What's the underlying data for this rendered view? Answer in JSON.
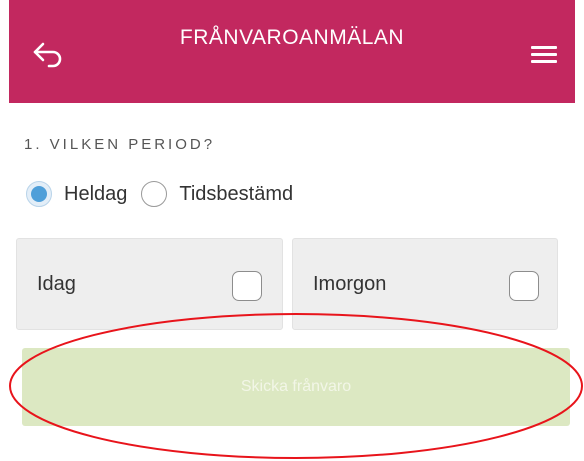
{
  "header": {
    "title": "FRÅNVAROANMÄLAN",
    "background_color": "#c2285f",
    "back_icon": "back-arrow-icon",
    "menu_icon": "hamburger-menu-icon"
  },
  "period": {
    "label": "1. VILKEN PERIOD?",
    "options": [
      {
        "label": "Heldag",
        "selected": true
      },
      {
        "label": "Tidsbestämd",
        "selected": false
      }
    ]
  },
  "days": [
    {
      "label": "Idag",
      "checked": false
    },
    {
      "label": "Imorgon",
      "checked": false
    }
  ],
  "submit": {
    "label": "Skicka frånvaro",
    "enabled": false,
    "color": "#dce8c2"
  },
  "annotation": {
    "type": "red-ellipse-around-submit-button",
    "color": "#e8141b"
  }
}
